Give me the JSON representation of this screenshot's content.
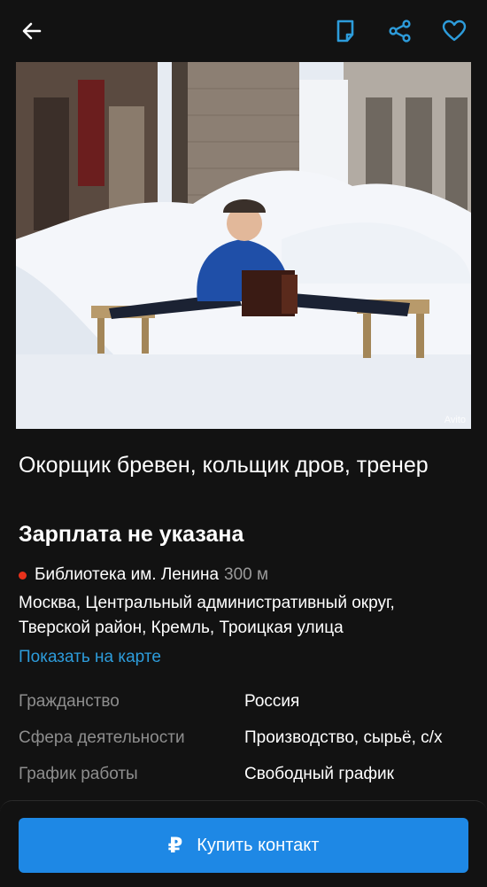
{
  "toolbar": {
    "icons": [
      "back-arrow-icon",
      "note-icon",
      "share-icon",
      "heart-icon"
    ],
    "accent_color": "#2d9cdb"
  },
  "photo": {
    "watermark": "Avito"
  },
  "listing": {
    "title": "Окорщик бревен, кольщик дров, тренер",
    "salary": "Зарплата не указана"
  },
  "location": {
    "metro_station": "Библиотека им. Ленина",
    "metro_distance": "300 м",
    "metro_color": "#e8311b",
    "address": "Москва, Центральный административный округ, Тверской район, Кремль, Троицкая улица",
    "map_link": "Показать на карте"
  },
  "params": [
    {
      "key": "Гражданство",
      "value": "Россия"
    },
    {
      "key": "Сфера деятельности",
      "value": "Производство, сырьё, с/х"
    },
    {
      "key": "График работы",
      "value": "Свободный график"
    }
  ],
  "cta": {
    "currency_symbol": "₽",
    "label": "Купить контакт",
    "color": "#1e88e5"
  }
}
